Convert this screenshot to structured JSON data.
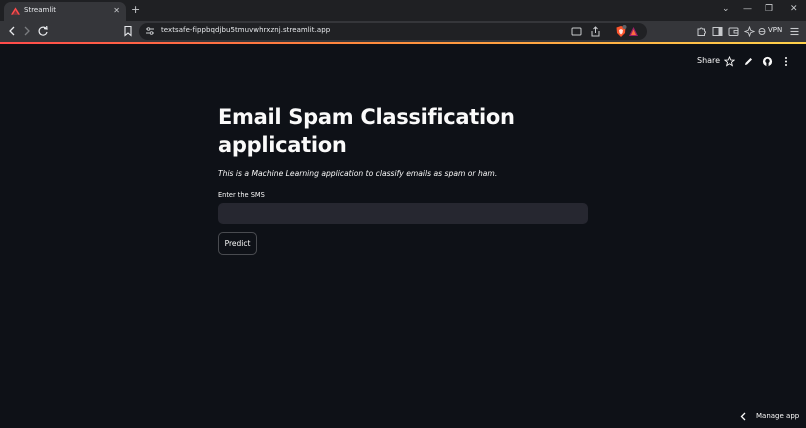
{
  "browser": {
    "tab": {
      "title": "Streamlit",
      "close_glyph": "✕"
    },
    "new_tab_glyph": "+",
    "window_controls": {
      "tab_search": "⌄",
      "minimize": "—",
      "restore": "❐",
      "close": "✕"
    },
    "url": "textsafe-fippbqdjbu5tmuvwhrxznj.streamlit.app",
    "vpn_label": "VPN"
  },
  "app": {
    "header": {
      "share_label": "Share"
    },
    "title": "Email Spam Classification application",
    "subtitle": "This is a Machine Learning application to classify emails as spam or ham.",
    "input": {
      "label": "Enter the SMS",
      "value": "",
      "placeholder": ""
    },
    "predict_button": "Predict",
    "manage_app": "Manage app"
  },
  "colors": {
    "background": "#0e1117",
    "input_bg": "#262730",
    "text": "#fafafa",
    "brand_gradient_start": "#ff4b4b",
    "brand_gradient_end": "#ffd24b"
  }
}
